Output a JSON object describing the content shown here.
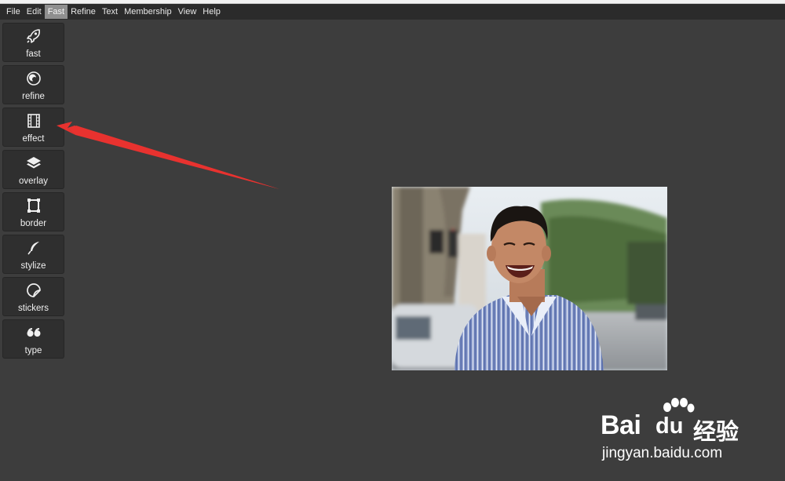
{
  "menu": {
    "items": [
      {
        "label": "File"
      },
      {
        "label": "Edit"
      },
      {
        "label": "Fast",
        "active": true
      },
      {
        "label": "Refine"
      },
      {
        "label": "Text"
      },
      {
        "label": "Membership"
      },
      {
        "label": "View"
      },
      {
        "label": "Help"
      }
    ]
  },
  "toolbar": {
    "tools": [
      {
        "label": "fast",
        "icon": "rocket-icon"
      },
      {
        "label": "refine",
        "icon": "refine-circle-icon"
      },
      {
        "label": "effect",
        "icon": "film-icon"
      },
      {
        "label": "overlay",
        "icon": "layers-icon"
      },
      {
        "label": "border",
        "icon": "frame-icon"
      },
      {
        "label": "stylize",
        "icon": "feather-icon"
      },
      {
        "label": "stickers",
        "icon": "sticker-icon"
      },
      {
        "label": "type",
        "icon": "quote-icon"
      }
    ]
  },
  "annotation": {
    "color": "#e8322f"
  },
  "watermark": {
    "main": "Bai",
    "paw": "du",
    "cn": "经验",
    "sub": "jingyan.baidu.com"
  }
}
